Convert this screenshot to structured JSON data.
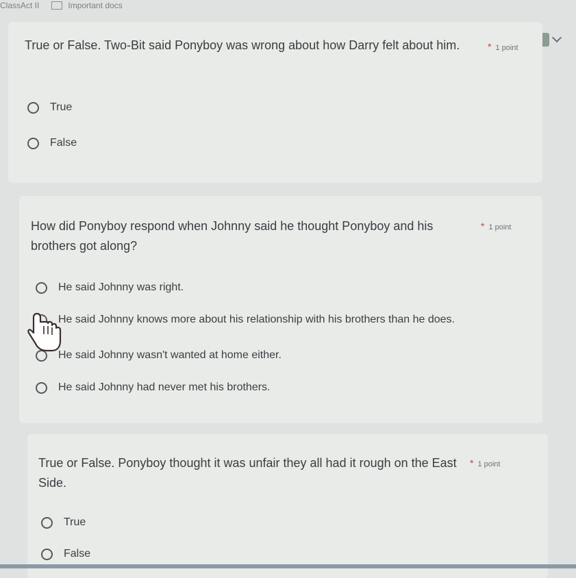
{
  "topbar": {
    "tab1": "ClassAct II",
    "tab2": "Important docs"
  },
  "questions": [
    {
      "text": "True or False. Two-Bit said Ponyboy was wrong about how Darry felt about him.",
      "points": "1 point",
      "required": "*",
      "options": [
        "True",
        "False"
      ]
    },
    {
      "text": "How did Ponyboy respond when Johnny said he thought Ponyboy and his brothers got along?",
      "points": "1 point",
      "required": "*",
      "options": [
        "He said Johnny was right.",
        "He said Johnny knows more about his relationship with his brothers than he does.",
        "He said Johnny wasn't wanted at home either.",
        "He said Johnny had never met his brothers."
      ]
    },
    {
      "text": "True or False. Ponyboy thought it was unfair they all had it rough on the East Side.",
      "points": "1 point",
      "required": "*",
      "options": [
        "True",
        "False"
      ]
    }
  ],
  "icons": {
    "addon": "addon-icon",
    "cursor": "hand-cursor-icon"
  }
}
